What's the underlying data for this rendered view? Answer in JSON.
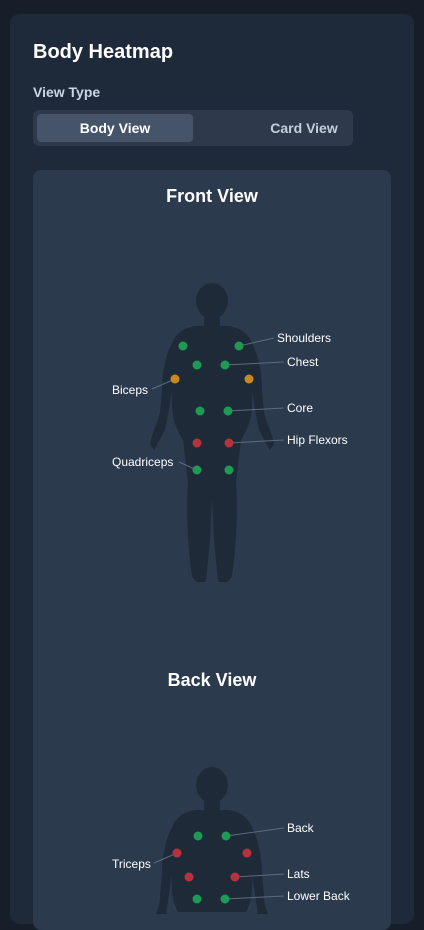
{
  "header": {
    "title": "Body Heatmap"
  },
  "view_type": {
    "label": "View Type",
    "options": [
      "Body View",
      "Card View"
    ],
    "selected": "Body View"
  },
  "colors": {
    "good": "#1f9a55",
    "warning": "#c8881f",
    "alert": "#b5333c"
  },
  "front": {
    "title": "Front View",
    "labels": {
      "shoulders": "Shoulders",
      "chest": "Chest",
      "biceps": "Biceps",
      "core": "Core",
      "hip_flexors": "Hip Flexors",
      "quadriceps": "Quadriceps"
    },
    "status": {
      "shoulders": "good",
      "chest": "good",
      "biceps": "warning",
      "core": "good",
      "hip_flexors": "alert",
      "quadriceps": "good"
    }
  },
  "back": {
    "title": "Back View",
    "labels": {
      "back": "Back",
      "triceps": "Triceps",
      "lats": "Lats",
      "lower_back": "Lower Back"
    },
    "status": {
      "back": "good",
      "triceps": "alert",
      "lats": "alert",
      "lower_back": "good"
    }
  }
}
